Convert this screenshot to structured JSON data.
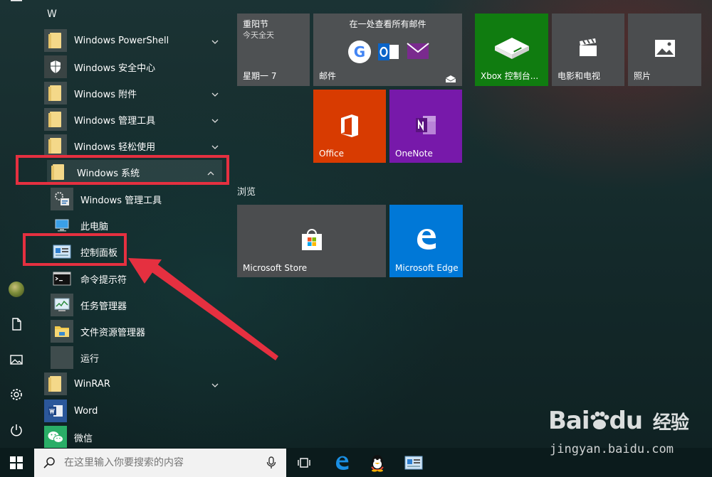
{
  "applist": {
    "section_letter": "W",
    "items": [
      {
        "label": "Windows PowerShell"
      },
      {
        "label": "Windows 安全中心"
      },
      {
        "label": "Windows 附件"
      },
      {
        "label": "Windows 管理工具"
      },
      {
        "label": "Windows 轻松使用"
      },
      {
        "label": "Windows 系统"
      },
      {
        "label": "Windows 管理工具"
      },
      {
        "label": "此电脑"
      },
      {
        "label": "控制面板"
      },
      {
        "label": "命令提示符"
      },
      {
        "label": "任务管理器"
      },
      {
        "label": "文件资源管理器"
      },
      {
        "label": "运行"
      },
      {
        "label": "WinRAR"
      },
      {
        "label": "Word"
      },
      {
        "label": "微信"
      }
    ]
  },
  "tiles": {
    "group_browse": "浏览",
    "calendar": {
      "title": "重阳节",
      "subtitle": "今天全天",
      "day": "星期一 7"
    },
    "mail": {
      "header": "在一处查看所有邮件",
      "label": "邮件"
    },
    "office": {
      "label": "Office"
    },
    "onenote": {
      "label": "OneNote"
    },
    "xbox": {
      "label": "Xbox 控制台..."
    },
    "movies": {
      "label": "电影和电视"
    },
    "photos": {
      "label": "照片"
    },
    "store": {
      "label": "Microsoft Store"
    },
    "edge": {
      "label": "Microsoft Edge"
    }
  },
  "taskbar": {
    "search_placeholder": "在这里输入你要搜索的内容"
  },
  "watermark": {
    "brand": "Bai",
    "brand_suffix": "du",
    "cn": "经验",
    "url": "jingyan.baidu.com"
  },
  "colors": {
    "office": "#d83b01",
    "onenote": "#7719aa",
    "xbox": "#107c10",
    "edge": "#0078d7",
    "tile_gray": "#4b4d4f",
    "annotation": "#e53040"
  }
}
